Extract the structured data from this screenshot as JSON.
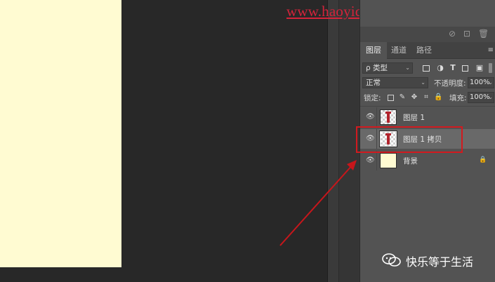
{
  "watermark": {
    "url_text": "www.haoyidiansheji.com"
  },
  "panel": {
    "tabs": [
      {
        "label": "图层",
        "active": true
      },
      {
        "label": "通道",
        "active": false
      },
      {
        "label": "路径",
        "active": false
      }
    ],
    "filter": {
      "kind_label": "ρ 类型"
    },
    "blend": {
      "mode": "正常",
      "opacity_label": "不透明度:",
      "opacity_value": "100%"
    },
    "lock": {
      "lock_label": "锁定:",
      "fill_label": "填充:",
      "fill_value": "100%"
    },
    "layers": [
      {
        "name": "图层 1",
        "thumb": "transparent",
        "selected": false,
        "locked": false
      },
      {
        "name": "图层 1 拷贝",
        "thumb": "transparent",
        "selected": true,
        "locked": false
      },
      {
        "name": "背景",
        "thumb": "cream",
        "selected": false,
        "locked": true
      }
    ]
  },
  "footer_watermark": {
    "text": "快乐等于生活"
  },
  "colors": {
    "canvas": "#fffbd2",
    "annotation": "#d21a1f",
    "panel": "#535353",
    "workspace": "#282828"
  }
}
